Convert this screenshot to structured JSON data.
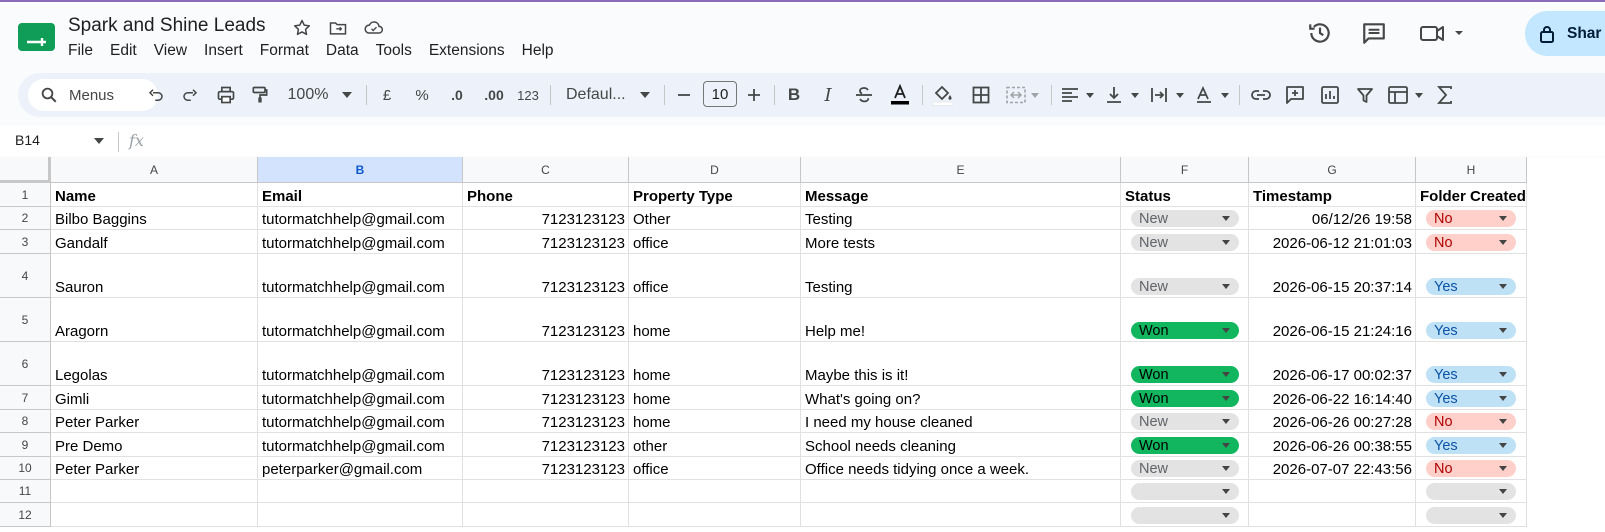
{
  "doc": {
    "title": "Spark and Shine Leads"
  },
  "menu": [
    "File",
    "Edit",
    "View",
    "Insert",
    "Format",
    "Data",
    "Tools",
    "Extensions",
    "Help"
  ],
  "share": {
    "label": "Shar"
  },
  "toolbar": {
    "search_label": "Menus",
    "zoom": "100%",
    "currency": "£",
    "percent": "%",
    "dec_decrease": ".0",
    "dec_increase": ".00",
    "number_format": "123",
    "font": "Defaul...",
    "font_size": "10"
  },
  "formula_bar": {
    "cell_ref": "B14",
    "fx": "fx"
  },
  "sheet": {
    "columns": [
      "A",
      "B",
      "C",
      "D",
      "E",
      "F",
      "G",
      "H"
    ],
    "selected_column": "B",
    "header": [
      "Name",
      "Email",
      "Phone",
      "Property Type",
      "Message",
      "Status",
      "Timestamp",
      "Folder Created"
    ],
    "rows": [
      {
        "num": "2",
        "name": "Bilbo Baggins",
        "email": "tutormatchhelp@gmail.com",
        "phone": "7123123123",
        "type": "Other",
        "message": "Testing",
        "status": "New",
        "timestamp": "06/12/26 19:58",
        "folder": "No"
      },
      {
        "num": "3",
        "name": "Gandalf",
        "email": "tutormatchhelp@gmail.com",
        "phone": "7123123123",
        "type": "office",
        "message": "More tests",
        "status": "New",
        "timestamp": "2026-06-12 21:01:03",
        "folder": "No"
      },
      {
        "num": "4",
        "name": "Sauron",
        "email": "tutormatchhelp@gmail.com",
        "phone": "7123123123",
        "type": "office",
        "message": "Testing",
        "status": "New",
        "timestamp": "2026-06-15 20:37:14",
        "folder": "Yes"
      },
      {
        "num": "5",
        "name": "Aragorn",
        "email": "tutormatchhelp@gmail.com",
        "phone": "7123123123",
        "type": "home",
        "message": "Help me!",
        "status": "Won",
        "timestamp": "2026-06-15 21:24:16",
        "folder": "Yes"
      },
      {
        "num": "6",
        "name": "Legolas",
        "email": "tutormatchhelp@gmail.com",
        "phone": "7123123123",
        "type": "home",
        "message": "Maybe this is it!",
        "status": "Won",
        "timestamp": "2026-06-17 00:02:37",
        "folder": "Yes"
      },
      {
        "num": "7",
        "name": "Gimli",
        "email": "tutormatchhelp@gmail.com",
        "phone": "7123123123",
        "type": "home",
        "message": "What's going on?",
        "status": "Won",
        "timestamp": "2026-06-22 16:14:40",
        "folder": "Yes"
      },
      {
        "num": "8",
        "name": "Peter Parker",
        "email": "tutormatchhelp@gmail.com",
        "phone": "7123123123",
        "type": "home",
        "message": "I need my house cleaned",
        "status": "New",
        "timestamp": "2026-06-26 00:27:28",
        "folder": "No"
      },
      {
        "num": "9",
        "name": "Pre Demo",
        "email": "tutormatchhelp@gmail.com",
        "phone": "7123123123",
        "type": "other",
        "message": "School needs cleaning",
        "status": "Won",
        "timestamp": "2026-06-26 00:38:55",
        "folder": "Yes"
      },
      {
        "num": "10",
        "name": "Peter Parker",
        "email": "peterparker@gmail.com",
        "phone": "7123123123",
        "type": "office",
        "message": "Office needs tidying once a week.",
        "status": "New",
        "timestamp": "2026-07-07 22:43:56",
        "folder": "No"
      }
    ],
    "empty_rows": [
      "11",
      "12"
    ],
    "header_row_num": "1"
  },
  "colors": {
    "won": "#11b65e",
    "new": "#e3e3e3",
    "no": "#ffcfc9",
    "yes": "#bfe1f6",
    "selected_column": "#d3e3fd",
    "share": "#c2e7ff"
  }
}
